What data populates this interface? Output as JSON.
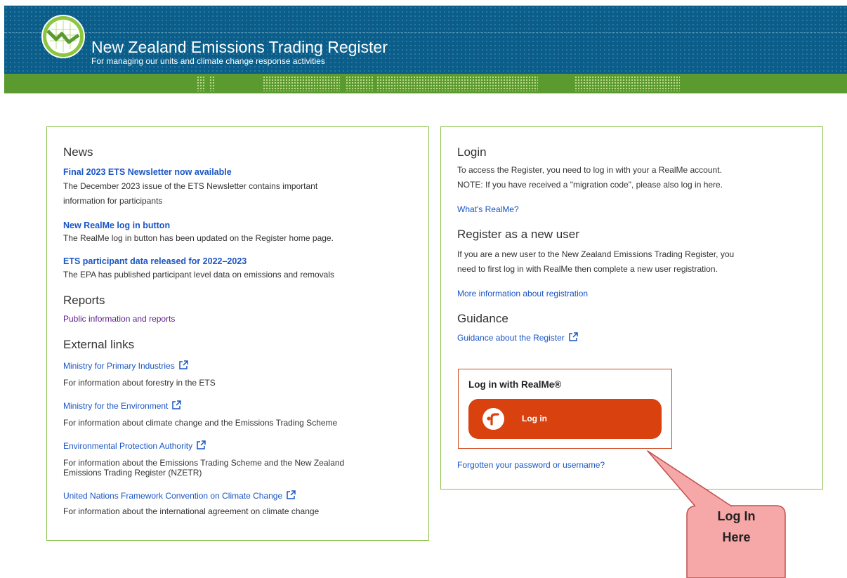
{
  "header": {
    "title": "New Zealand Emissions Trading Register",
    "tagline": "For managing our units and climate change response activities"
  },
  "news": {
    "heading": "News",
    "items": [
      {
        "title": "Final 2023 ETS Newsletter now available",
        "lines": [
          "The December 2023 issue of the ETS Newsletter contains important",
          "information for participants"
        ]
      },
      {
        "title": "New RealMe log in button",
        "lines": [
          "The RealMe log in button has been updated on the Register home page."
        ]
      },
      {
        "title": "ETS participant data released for 2022–2023",
        "lines": [
          "The EPA has published participant level data on emissions and removals"
        ]
      }
    ]
  },
  "reports": {
    "heading": "Reports",
    "link": "Public information and reports"
  },
  "external": {
    "heading": "External links",
    "items": [
      {
        "label": "Ministry for Primary Industries",
        "lines": [
          "For information about forestry in the ETS"
        ]
      },
      {
        "label": "Ministry for the Environment",
        "lines": [
          "For information about climate change and the Emissions Trading Scheme"
        ]
      },
      {
        "label": "Environmental Protection Authority",
        "lines": [
          "For information about the Emissions Trading Scheme and the New Zealand",
          "Emissions Trading Register (NZETR)"
        ]
      },
      {
        "label": "United Nations Framework Convention on Climate Change",
        "lines": [
          "For information about the international agreement on climate change"
        ]
      }
    ]
  },
  "login": {
    "heading": "Login",
    "lines": [
      "To access the Register, you need to log in with your a RealMe account.",
      "NOTE: If you have received a \"migration code\", please also log in here."
    ],
    "whats_realme": "What's RealMe?"
  },
  "register": {
    "heading": "Register as a new user",
    "lines": [
      "If you are a new user to the New Zealand Emissions Trading Register, you",
      "need to first log in with RealMe then complete a new user registration."
    ],
    "link": "More information about registration"
  },
  "guidance": {
    "heading": "Guidance",
    "link": "Guidance about the Register"
  },
  "realme": {
    "title": "Log in with RealMe®",
    "button": "Log in"
  },
  "forgot": "Forgotten your password or username?",
  "callout": {
    "line1": "Log In",
    "line2": "Here"
  },
  "colors": {
    "header_blue": "#0b5e8a",
    "band_green": "#5b9a2e",
    "panel_border": "#8bc34a",
    "link_blue": "#1a55c4",
    "realme_orange": "#d9410f",
    "callout_fill": "#f6a7a7"
  },
  "icons": [
    "etr-logo-icon",
    "external-link-icon",
    "realme-logo-icon"
  ]
}
